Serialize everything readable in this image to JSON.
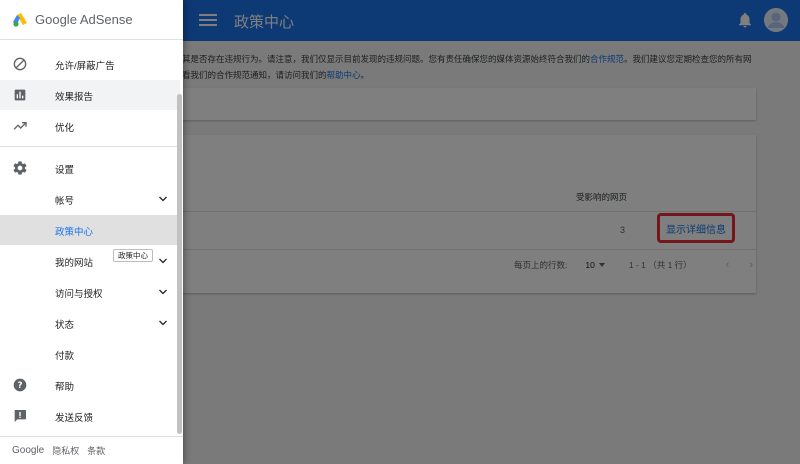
{
  "topbar": {
    "title": "政策中心",
    "accent": "#1a73e8"
  },
  "main": {
    "notice_line1_prefix": "其是否存在违规行为。请注意，我们仅显示目前发现的违规问题。您有责任确保您的媒体资源始终符合我们的",
    "notice_link1": "合作规范",
    "notice_line1_suffix": "。我们建议您定期检查您的所有网",
    "notice_line2_prefix": "看我们的合作规范通知，请访问我们的",
    "notice_link2": "帮助中心",
    "notice_line2_suffix": "。",
    "table": {
      "column_affected": "受影响的网页",
      "rows": [
        {
          "count": "3",
          "action": "显示详细信息"
        }
      ]
    },
    "pager": {
      "rows_per_page_label": "每页上的行数:",
      "rows_per_page_value": "10",
      "range": "1 - 1 （共 1 行）",
      "prev": "‹",
      "next": "›"
    }
  },
  "drawer": {
    "logo": "Google AdSense",
    "items": [
      {
        "label": "允许/屏蔽广告",
        "icon": "block-icon"
      },
      {
        "label": "效果报告",
        "icon": "bar-chart-icon"
      },
      {
        "label": "优化",
        "icon": "trending-up-icon"
      },
      {
        "label": "设置",
        "icon": "gear-icon"
      },
      {
        "label": "帐号",
        "icon": "chevron-down-icon"
      },
      {
        "label": "政策中心"
      },
      {
        "label": "我的网站",
        "icon": "chevron-down-icon"
      },
      {
        "label": "访问与授权",
        "icon": "chevron-down-icon"
      },
      {
        "label": "状态",
        "icon": "chevron-down-icon"
      },
      {
        "label": "付款"
      },
      {
        "label": "帮助",
        "icon": "help-icon"
      },
      {
        "label": "发送反馈",
        "icon": "feedback-icon"
      }
    ],
    "tooltip": "政策中心",
    "footer": {
      "brand": "Google",
      "privacy": "隐私权",
      "terms": "条款"
    }
  },
  "colors": {
    "highlight_border": "#ea2c3a",
    "active_label": "#1a73e8"
  }
}
